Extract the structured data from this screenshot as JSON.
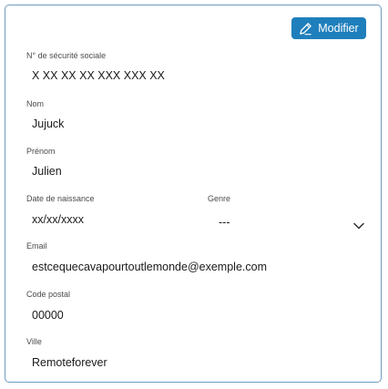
{
  "header": {
    "edit_label": "Modifier"
  },
  "fields": {
    "ssn": {
      "label": "N° de sécurité sociale",
      "value": "X XX XX XX XXX XXX XX"
    },
    "nom": {
      "label": "Nom",
      "value": "Jujuck"
    },
    "prenom": {
      "label": "Prénom",
      "value": "Julien"
    },
    "birthdate": {
      "label": "Date de naissance",
      "value": "xx/xx/xxxx"
    },
    "genre": {
      "label": "Genre",
      "value": "---"
    },
    "email": {
      "label": "Email",
      "value": "estcequecavapourtoutlemonde@exemple.com"
    },
    "postal_code": {
      "label": "Code postal",
      "value": "00000"
    },
    "ville": {
      "label": "Ville",
      "value": "Remoteforever"
    }
  },
  "icons": {
    "edit": "pencil-icon",
    "select": "chevron-down-icon"
  },
  "colors": {
    "accent": "#1f7fbc",
    "border": "#6e9bc0"
  }
}
